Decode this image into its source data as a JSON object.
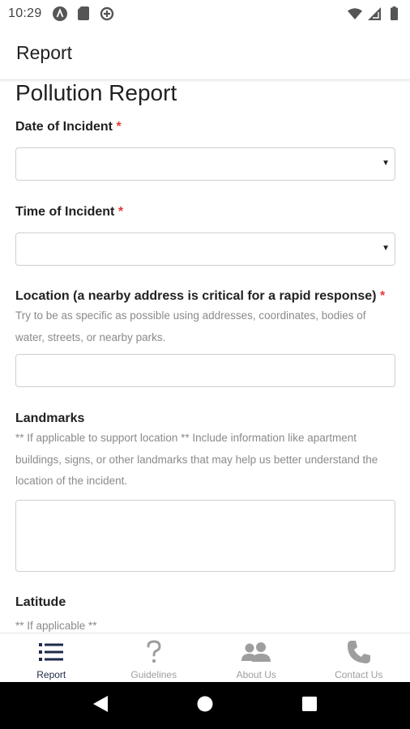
{
  "status_bar": {
    "time": "10:29",
    "left_icons": [
      "a-circle-icon",
      "sd-card-icon",
      "data-saver-icon"
    ],
    "right_icons": [
      "wifi-icon",
      "signal-icon",
      "battery-icon"
    ]
  },
  "app_bar": {
    "title": "Report"
  },
  "form": {
    "title": "Pollution Report",
    "required_marker": "*",
    "date": {
      "label": "Date of Incident"
    },
    "time": {
      "label": "Time of Incident"
    },
    "location": {
      "label": "Location (a nearby address is critical for a rapid response)",
      "help": "Try to be as specific as possible using addresses, coordinates, bodies of water, streets, or nearby parks."
    },
    "landmarks": {
      "label": "Landmarks",
      "help": "** If applicable to support location ** Include information like apartment buildings, signs, or other landmarks that may help us better understand the location of the incident."
    },
    "latitude": {
      "label": "Latitude",
      "help": "** If applicable **"
    }
  },
  "bottom_nav": {
    "items": [
      {
        "label": "Report",
        "icon": "list-icon",
        "active": true
      },
      {
        "label": "Guidelines",
        "icon": "question-icon",
        "active": false
      },
      {
        "label": "About Us",
        "icon": "users-icon",
        "active": false
      },
      {
        "label": "Contact Us",
        "icon": "phone-icon",
        "active": false
      }
    ]
  },
  "colors": {
    "accent": "#1e2a4a",
    "required": "#e53935",
    "inactive": "#9e9e9e"
  },
  "android_nav": {
    "buttons": [
      "back-icon",
      "home-icon",
      "recents-icon"
    ]
  }
}
